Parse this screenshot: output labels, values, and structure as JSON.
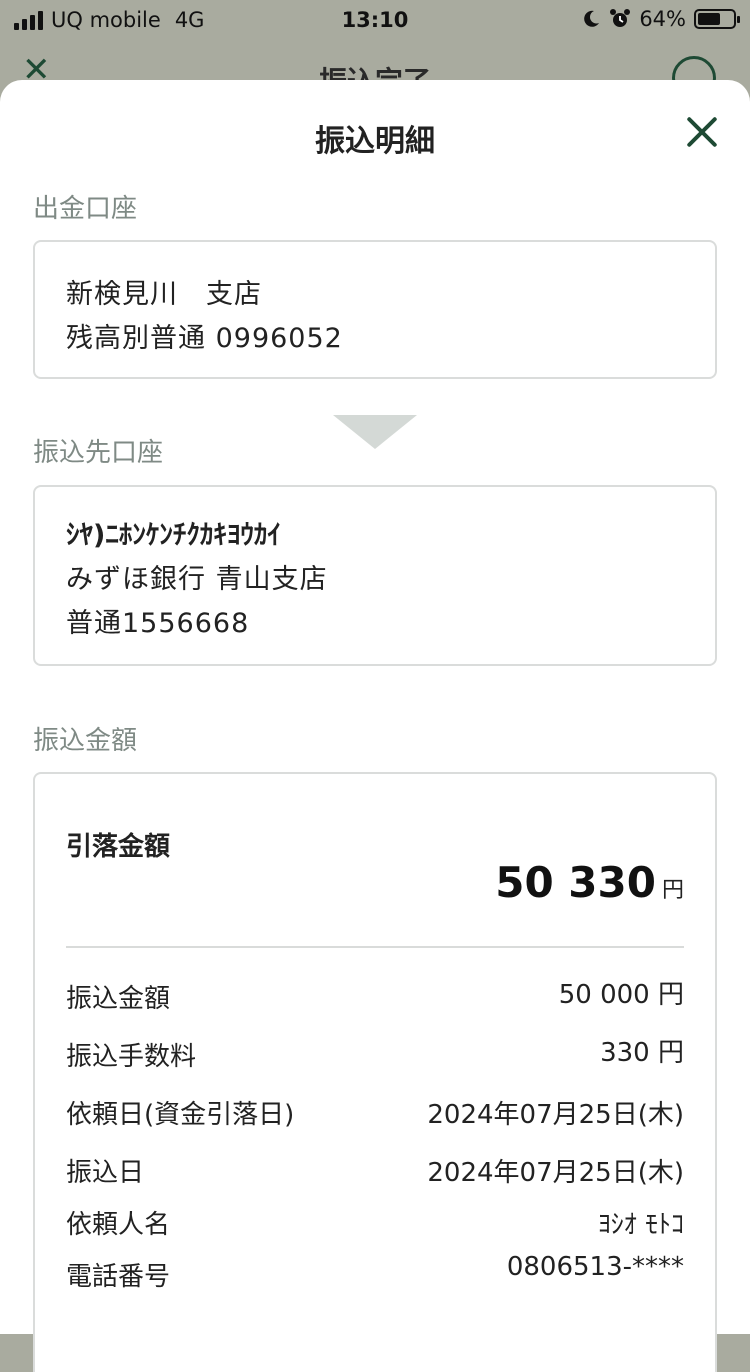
{
  "status_bar": {
    "carrier": "UQ mobile",
    "network": "4G",
    "time": "13:10",
    "battery_percent": "64%",
    "battery_level": 0.64
  },
  "background": {
    "title": "振込完了"
  },
  "sheet": {
    "title": "振込明細"
  },
  "from_account": {
    "label": "出金口座",
    "branch": "新検見川　支店",
    "account": "残高別普通 0996052"
  },
  "to_account": {
    "label": "振込先口座",
    "name": "ｼﾔ)ﾆﾎﾝｹﾝﾁｸｶｷﾖｳｶｲ",
    "bank": "みずほ銀行 青山支店",
    "account": "普通1556668"
  },
  "amount": {
    "label": "振込金額",
    "total_label": "引落金額",
    "total_value": "50 330",
    "total_unit": "円",
    "rows": [
      {
        "label": "振込金額",
        "value": "50 000 円"
      },
      {
        "label": "振込手数料",
        "value": "330 円"
      },
      {
        "label": "依頼日(資金引落日)",
        "value": "2024年07月25日(木)"
      },
      {
        "label": "振込日",
        "value": "2024年07月25日(木)"
      },
      {
        "label": "依頼人名",
        "value": "ﾖｼｵ ﾓﾄｺ"
      },
      {
        "label": "電話番号",
        "value": "0806513-****"
      }
    ]
  },
  "colors": {
    "accent": "#1e4a34",
    "section_label": "#7f8a85",
    "card_border": "#dadcdb"
  }
}
